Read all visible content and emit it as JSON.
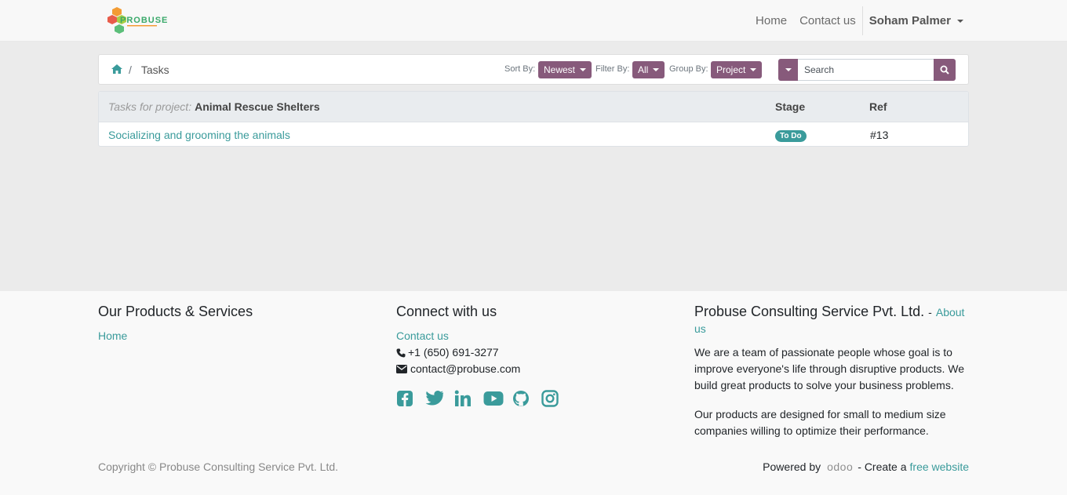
{
  "header": {
    "logo_text": "PROBUSE",
    "nav": {
      "home": "Home",
      "contact": "Contact us",
      "user": "Soham Palmer"
    }
  },
  "toolbar": {
    "breadcrumb_current": "Tasks",
    "sort_label": "Sort By:",
    "sort_value": "Newest",
    "filter_label": "Filter By:",
    "filter_value": "All",
    "group_label": "Group By:",
    "group_value": "Project",
    "search_placeholder": "Search"
  },
  "table": {
    "project_prefix": "Tasks for project:",
    "project_name": "Animal Rescue Shelters",
    "col_stage": "Stage",
    "col_ref": "Ref",
    "rows": [
      {
        "name": "Socializing and grooming the animals",
        "stage": "To Do",
        "ref": "#13"
      }
    ]
  },
  "footer": {
    "col1_title": "Our Products & Services",
    "col1_link": "Home",
    "col2_title": "Connect with us",
    "col2_link": "Contact us",
    "phone": "+1 (650) 691-3277",
    "email": "contact@probuse.com",
    "col3_title": "Probuse Consulting Service Pvt. Ltd.",
    "col3_sep": "-",
    "col3_link": "About us",
    "col3_p1": "We are a team of passionate people whose goal is to improve everyone's life through disruptive products. We build great products to solve your business problems.",
    "col3_p2": "Our products are designed for small to medium size companies willing to optimize their performance.",
    "copyright": "Copyright © Probuse Consulting Service Pvt. Ltd.",
    "powered_by": "Powered by",
    "odoo": "odoo",
    "create_text": "- Create a",
    "free_website": "free website"
  },
  "colors": {
    "accent": "#875a7b",
    "link": "#3a9b9b",
    "social": "#3a9b9b"
  }
}
